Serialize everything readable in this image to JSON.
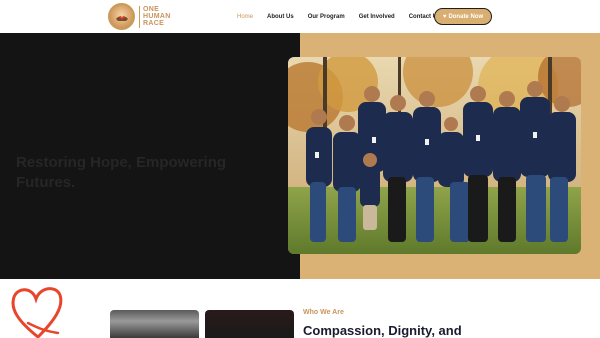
{
  "header": {
    "logo": {
      "line1": "ONE",
      "line2": "HUMAN",
      "line3": "RACE",
      "icon": "hands-heart-logo-icon"
    },
    "nav": [
      {
        "label": "Home",
        "active": true
      },
      {
        "label": "About Us",
        "active": false
      },
      {
        "label": "Our Program",
        "active": false
      },
      {
        "label": "Get Involved",
        "active": false
      },
      {
        "label": "Contact Us",
        "active": false
      }
    ],
    "donate": {
      "label": "Donate Now",
      "icon": "heart-icon"
    }
  },
  "hero": {
    "title": "Restoring Hope, Empowering Futures.",
    "image": "group-photo-volunteers"
  },
  "about": {
    "label": "Who We Are",
    "title": "Compassion, Dignity, and"
  },
  "colors": {
    "accent": "#c8955a",
    "gold_panel": "#dbb276",
    "hero_dark": "#141414",
    "heart_red": "#e8452c"
  }
}
